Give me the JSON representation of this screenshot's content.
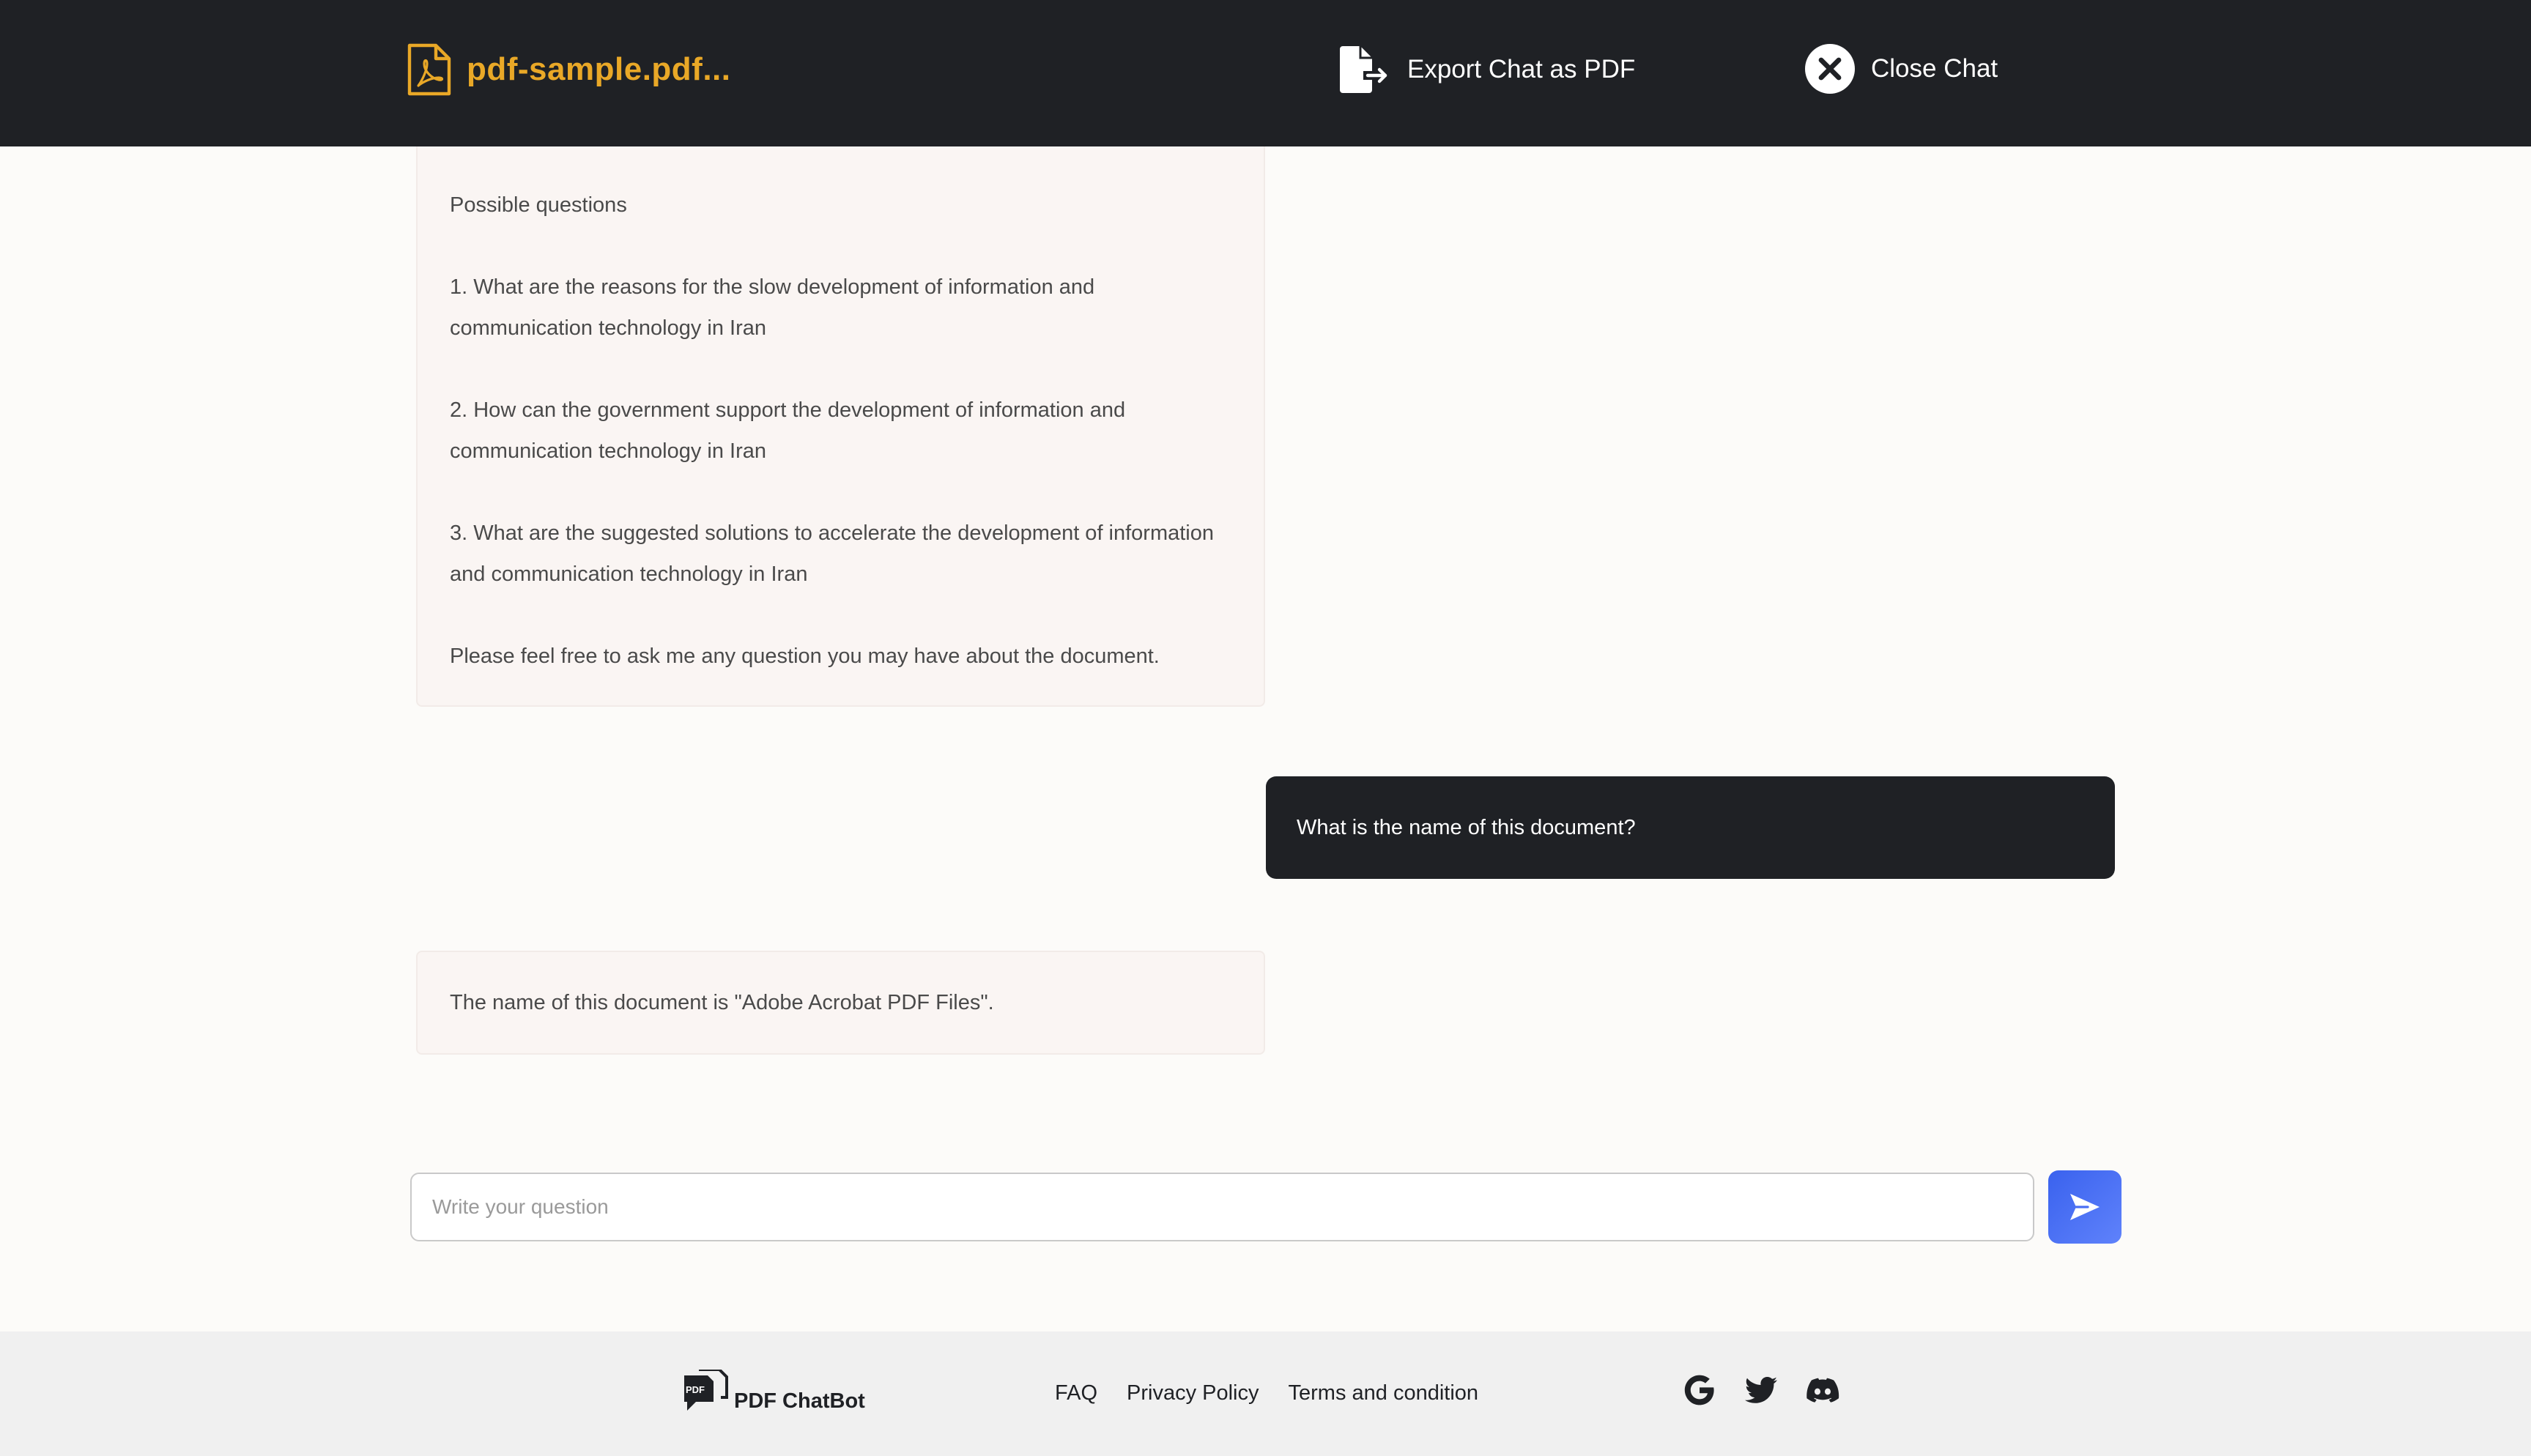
{
  "header": {
    "file_name": "pdf-sample.pdf...",
    "export_label": "Export Chat as PDF",
    "close_label": "Close Chat"
  },
  "chat": {
    "messages": [
      {
        "role": "bot",
        "paragraphs": [
          "Possible questions",
          "1. What are the reasons for the slow development of information and communication technology in Iran",
          "2. How can the government support the development of information and communication technology in Iran",
          "3. What are the suggested solutions to accelerate the development of information and communication technology in Iran",
          "Please feel free to ask me any question you may have about the document."
        ]
      },
      {
        "role": "user",
        "text": "What is the name of this document?"
      },
      {
        "role": "bot",
        "text": "The name of this document is \"Adobe Acrobat PDF Files\"."
      }
    ]
  },
  "input": {
    "placeholder": "Write your question",
    "value": ""
  },
  "footer": {
    "brand_name": "PDF ChatBot",
    "brand_badge": "PDF",
    "links": [
      "FAQ",
      "Privacy Policy",
      "Terms and condition"
    ],
    "socials": [
      {
        "name": "google",
        "icon": "google-icon"
      },
      {
        "name": "twitter",
        "icon": "twitter-icon"
      },
      {
        "name": "discord",
        "icon": "discord-icon"
      }
    ]
  },
  "colors": {
    "header_bg": "#1f2125",
    "accent_file": "#e9a827",
    "send_button": "#4a6ff3",
    "bot_bubble": "#faf5f3",
    "user_bubble": "#1f2125",
    "footer_bg": "#f0f0f0"
  }
}
